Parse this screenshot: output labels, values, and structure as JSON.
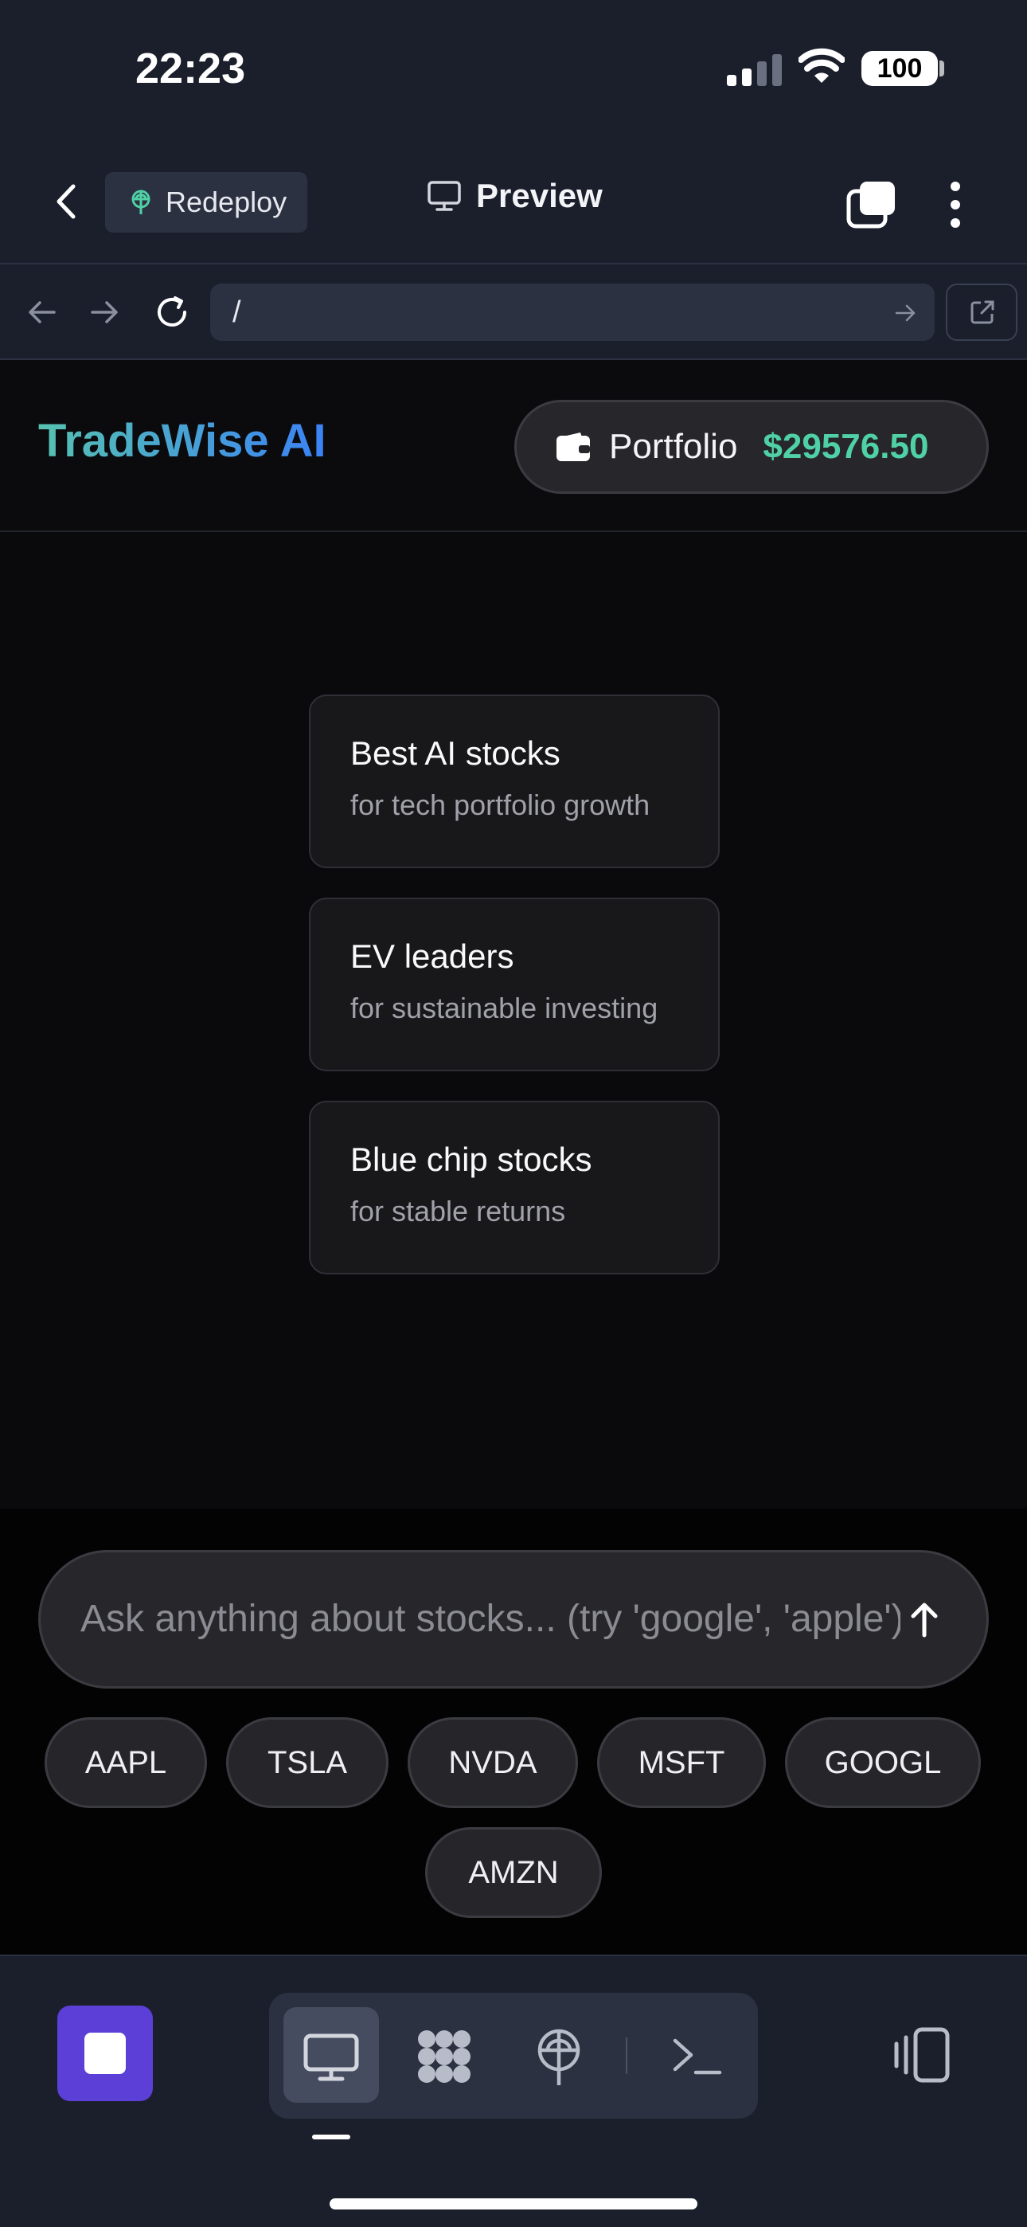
{
  "status_bar": {
    "time": "22:23",
    "battery": "100"
  },
  "toolbar": {
    "redeploy_label": "Redeploy",
    "preview_label": "Preview"
  },
  "browser": {
    "url": "/"
  },
  "app": {
    "brand": "TradeWise AI",
    "portfolio_label": "Portfolio",
    "portfolio_value": "$29576.50",
    "suggestions": [
      {
        "title": "Best AI stocks",
        "subtitle": "for tech portfolio growth"
      },
      {
        "title": "EV leaders",
        "subtitle": "for sustainable investing"
      },
      {
        "title": "Blue chip stocks",
        "subtitle": "for stable returns"
      }
    ],
    "ask_placeholder": "Ask anything about stocks... (try 'google', 'apple')",
    "tickers": [
      "AAPL",
      "TSLA",
      "NVDA",
      "MSFT",
      "GOOGL",
      "AMZN"
    ]
  },
  "colors": {
    "accent_purple": "#5b3fd6",
    "portfolio_green": "#4fd1a5",
    "brand_gradient_start": "#56c2b1",
    "brand_gradient_end": "#3b82f6"
  },
  "icons": {
    "tab_bar": [
      "desktop-icon",
      "nodes-icon",
      "globe-deploy-icon",
      "terminal-icon"
    ],
    "side": "panel-toggle-icon"
  }
}
